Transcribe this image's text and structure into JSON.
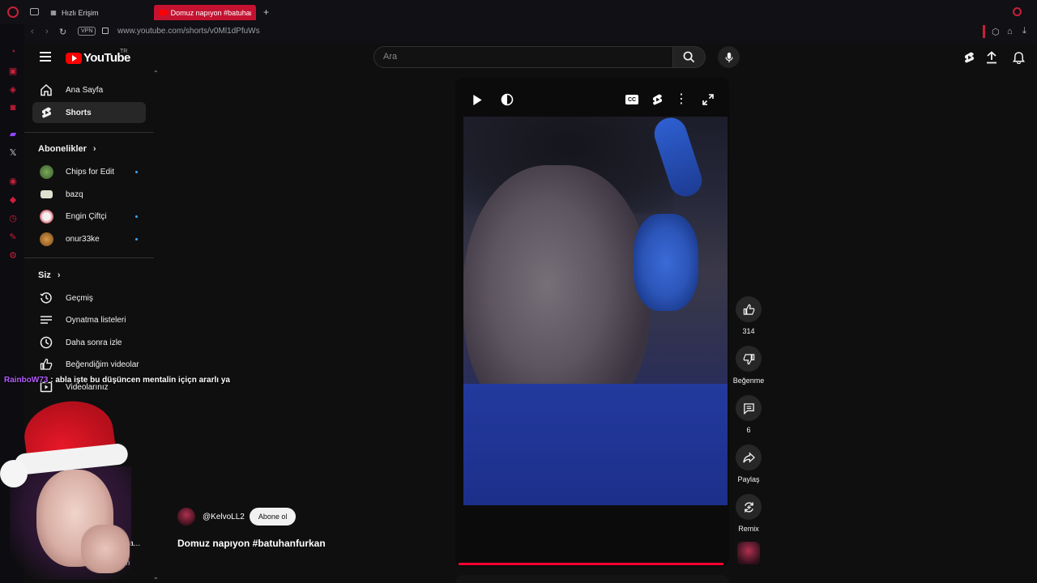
{
  "browser": {
    "tabs": [
      {
        "label": "Hızlı Erişim",
        "active": false
      },
      {
        "label": "Domuz napıyon #batuhan",
        "active": true
      }
    ],
    "new_tab": "+",
    "vpn_badge": "VPN",
    "url": "www.youtube.com/shorts/v0Ml1dPfuWs"
  },
  "header": {
    "logo_text": "YouTube",
    "region": "TR",
    "search_placeholder": "Ara"
  },
  "sidebar": {
    "main": [
      {
        "label": "Ana Sayfa",
        "icon": "home-icon"
      },
      {
        "label": "Shorts",
        "icon": "shorts-icon",
        "active": true
      }
    ],
    "subscriptions_heading": "Abonelikler",
    "subscriptions": [
      {
        "label": "Chips for Edit",
        "new": true,
        "color": "#5a8a3a"
      },
      {
        "label": "bazq",
        "new": false,
        "color": "#d0d0c0"
      },
      {
        "label": "Engin Çiftçi",
        "new": true,
        "color": "#e8e0e0"
      },
      {
        "label": "onur33ke",
        "new": true,
        "color": "#c08a3a"
      }
    ],
    "you_heading": "Siz",
    "you": [
      {
        "label": "Geçmiş",
        "icon": "history-icon"
      },
      {
        "label": "Oynatma listeleri",
        "icon": "playlist-icon"
      },
      {
        "label": "Daha sonra izle",
        "icon": "clock-icon"
      },
      {
        "label": "Beğendiğim videolar",
        "icon": "thumbs-up-icon"
      },
      {
        "label": "Videolarınız",
        "icon": "video-icon"
      }
    ],
    "partial_labels": [
      "r",
      "zla...",
      "m"
    ]
  },
  "video": {
    "channel": "@KelvoLL2",
    "subscribe_label": "Abone ol",
    "title": "Domuz napıyon #batuhanfurkan",
    "progress_fraction": 1.0
  },
  "actions": [
    {
      "name": "like",
      "caption": "314",
      "icon": "thumbs-up-icon"
    },
    {
      "name": "dislike",
      "caption": "Beğenme",
      "icon": "thumbs-down-icon"
    },
    {
      "name": "comments",
      "caption": "6",
      "icon": "comment-icon"
    },
    {
      "name": "share",
      "caption": "Paylaş",
      "icon": "share-icon"
    },
    {
      "name": "remix",
      "caption": "Remix",
      "icon": "remix-icon"
    }
  ],
  "stream_chat": {
    "user": "RainboW73",
    "message": ": abla işte bu düşüncen mentalin içiçn ararlı ya"
  },
  "colors": {
    "accent": "#ff0033",
    "browser_accent": "#c41230",
    "background": "#0f0f0f"
  }
}
